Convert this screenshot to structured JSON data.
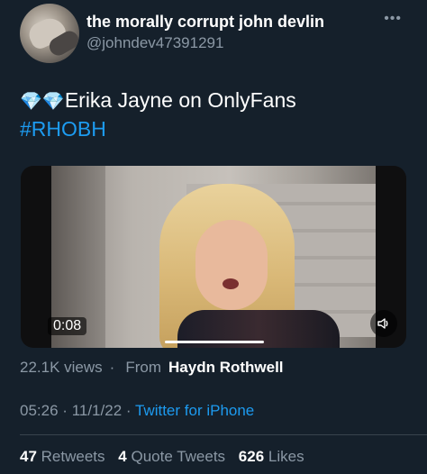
{
  "user": {
    "display_name": "the morally corrupt john devlin",
    "handle": "@johndev47391291"
  },
  "more_label": "•••",
  "tweet": {
    "emoji": "💎💎",
    "text": "Erika Jayne on OnlyFans",
    "hashtag": "#RHOBH"
  },
  "media": {
    "duration": "0:08",
    "volume_icon": "speaker-icon",
    "progress_fraction": 0.3
  },
  "meta": {
    "views": "22.1K views",
    "separator": "·",
    "from_label": "From",
    "from_name": "Haydn Rothwell"
  },
  "timestamp": {
    "time": "05:26",
    "date": "11/1/22",
    "source": "Twitter for iPhone"
  },
  "stats": {
    "retweets_count": "47",
    "retweets_label": "Retweets",
    "quotes_count": "4",
    "quotes_label": "Quote Tweets",
    "likes_count": "626",
    "likes_label": "Likes"
  },
  "colors": {
    "background": "#15202b",
    "accent": "#1d9bf0",
    "secondary_text": "#8b98a5"
  }
}
